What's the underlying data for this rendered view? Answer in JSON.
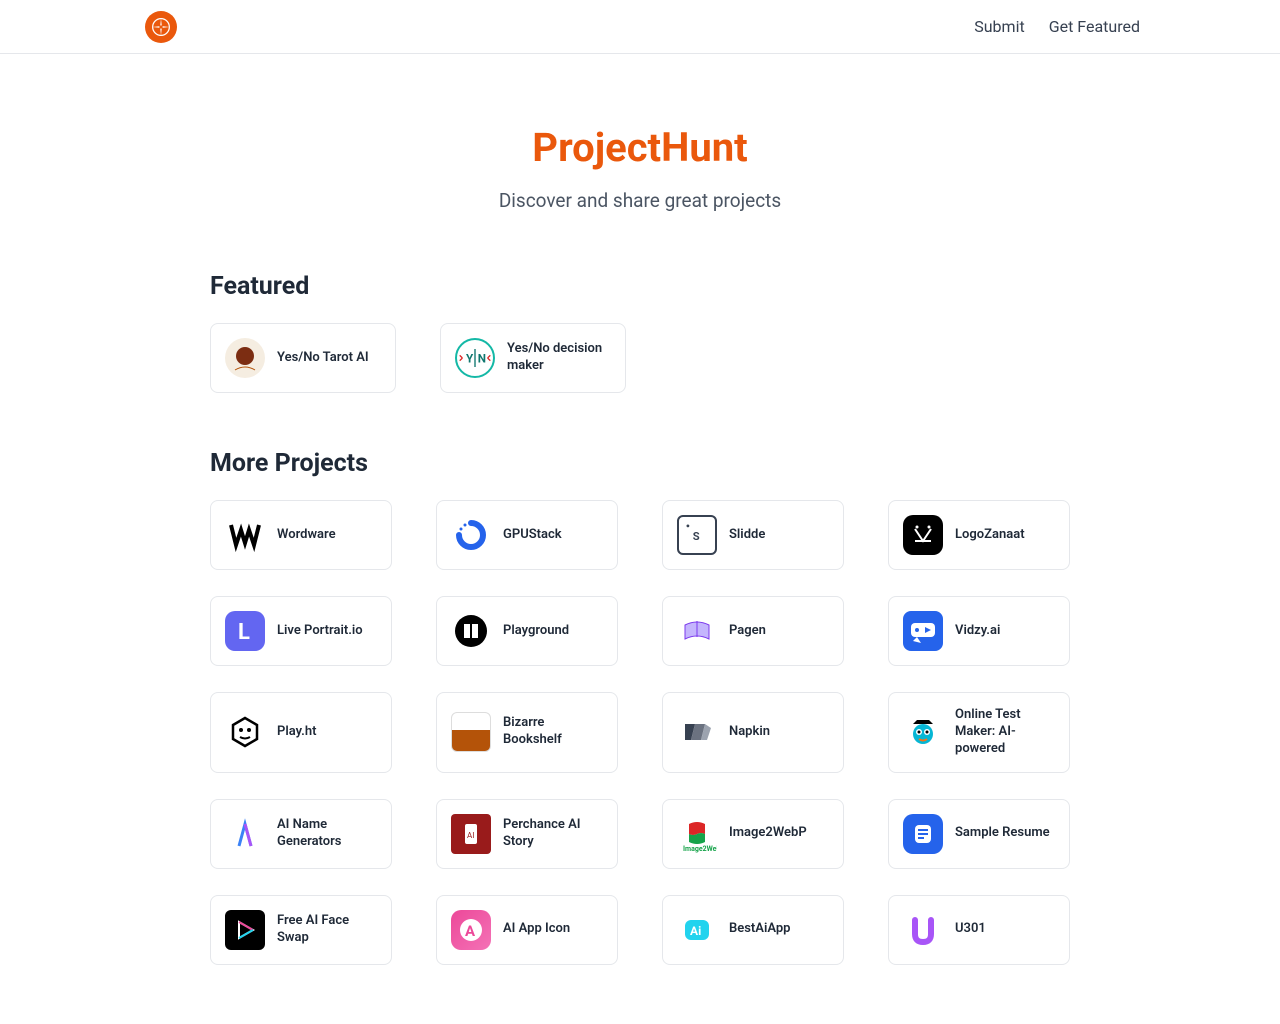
{
  "nav": {
    "submit": "Submit",
    "get_featured": "Get Featured"
  },
  "hero": {
    "title": "ProjectHunt",
    "subtitle": "Discover and share great projects"
  },
  "sections": {
    "featured_title": "Featured",
    "more_title": "More Projects"
  },
  "featured": [
    {
      "title": "Yes/No Tarot AI",
      "icon": "tarot-icon"
    },
    {
      "title": "Yes/No decision maker",
      "icon": "yn-icon"
    }
  ],
  "projects": [
    {
      "title": "Wordware",
      "icon": "wordware-icon"
    },
    {
      "title": "GPUStack",
      "icon": "gpustack-icon"
    },
    {
      "title": "Slidde",
      "icon": "slidde-icon"
    },
    {
      "title": "LogoZanaat",
      "icon": "logozanaat-icon"
    },
    {
      "title": "Live Portrait.io",
      "icon": "liveportrait-icon"
    },
    {
      "title": "Playground",
      "icon": "playground-icon"
    },
    {
      "title": "Pagen",
      "icon": "pagen-icon"
    },
    {
      "title": "Vidzy.ai",
      "icon": "vidzy-icon"
    },
    {
      "title": "Play.ht",
      "icon": "playht-icon"
    },
    {
      "title": "Bizarre Bookshelf",
      "icon": "bizarre-icon"
    },
    {
      "title": "Napkin",
      "icon": "napkin-icon"
    },
    {
      "title": "Online Test Maker: AI-powered",
      "icon": "testmaker-icon"
    },
    {
      "title": "AI Name Generators",
      "icon": "ainame-icon"
    },
    {
      "title": "Perchance AI Story",
      "icon": "perchance-icon"
    },
    {
      "title": "Image2WebP",
      "icon": "image2webp-icon"
    },
    {
      "title": "Sample Resume",
      "icon": "sampleresume-icon"
    },
    {
      "title": "Free AI Face Swap",
      "icon": "faceswap-icon"
    },
    {
      "title": "AI App Icon",
      "icon": "aiappicon-icon"
    },
    {
      "title": "BestAiApp",
      "icon": "bestaiapp-icon"
    },
    {
      "title": "U301",
      "icon": "u301-icon"
    }
  ]
}
